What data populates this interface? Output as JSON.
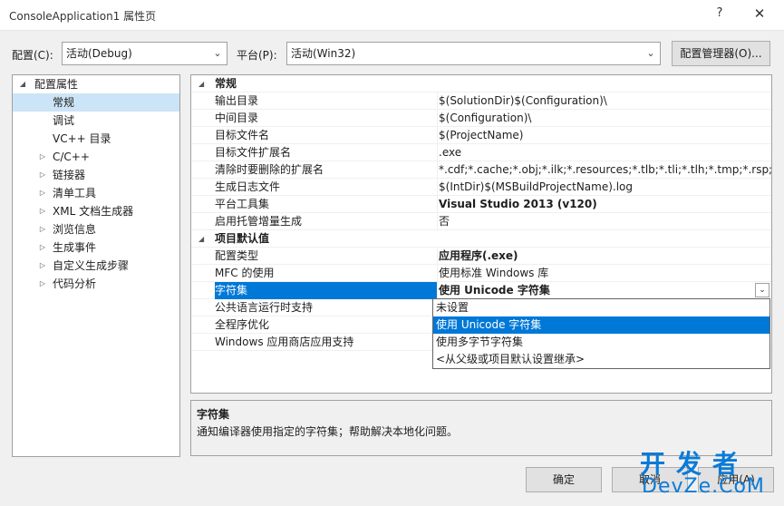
{
  "window": {
    "title": "ConsoleApplication1 属性页",
    "help_label": "?",
    "close_label": "✕"
  },
  "toolbar": {
    "config_label": "配置(C):",
    "config_value": "活动(Debug)",
    "platform_label": "平台(P):",
    "platform_value": "活动(Win32)",
    "config_manager_label": "配置管理器(O)...",
    "dropdown_arrow": "⌄"
  },
  "tree": {
    "root": {
      "label": "配置属性",
      "expander": "◢"
    },
    "items": [
      {
        "label": "常规",
        "expander": "",
        "selected": true
      },
      {
        "label": "调试",
        "expander": ""
      },
      {
        "label": "VC++ 目录",
        "expander": ""
      },
      {
        "label": "C/C++",
        "expander": "▷"
      },
      {
        "label": "链接器",
        "expander": "▷"
      },
      {
        "label": "清单工具",
        "expander": "▷"
      },
      {
        "label": "XML 文档生成器",
        "expander": "▷"
      },
      {
        "label": "浏览信息",
        "expander": "▷"
      },
      {
        "label": "生成事件",
        "expander": "▷"
      },
      {
        "label": "自定义生成步骤",
        "expander": "▷"
      },
      {
        "label": "代码分析",
        "expander": "▷"
      }
    ]
  },
  "grid": {
    "sections": [
      {
        "title": "常规",
        "expander": "◢",
        "rows": [
          {
            "name": "输出目录",
            "value": "$(SolutionDir)$(Configuration)\\"
          },
          {
            "name": "中间目录",
            "value": "$(Configuration)\\"
          },
          {
            "name": "目标文件名",
            "value": "$(ProjectName)"
          },
          {
            "name": "目标文件扩展名",
            "value": ".exe"
          },
          {
            "name": "清除时要删除的扩展名",
            "value": "*.cdf;*.cache;*.obj;*.ilk;*.resources;*.tlb;*.tli;*.tlh;*.tmp;*.rsp;*.pgc;*"
          },
          {
            "name": "生成日志文件",
            "value": "$(IntDir)$(MSBuildProjectName).log"
          },
          {
            "name": "平台工具集",
            "value": "Visual Studio 2013 (v120)",
            "bold": true
          },
          {
            "name": "启用托管增量生成",
            "value": "否"
          }
        ]
      },
      {
        "title": "项目默认值",
        "expander": "◢",
        "rows": [
          {
            "name": "配置类型",
            "value": "应用程序(.exe)",
            "bold": true
          },
          {
            "name": "MFC 的使用",
            "value": "使用标准 Windows 库"
          },
          {
            "name": "字符集",
            "value": "使用 Unicode 字符集",
            "selected": true
          },
          {
            "name": "公共语言运行时支持",
            "value": ""
          },
          {
            "name": "全程序优化",
            "value": ""
          },
          {
            "name": "Windows 应用商店应用支持",
            "value": ""
          }
        ]
      }
    ],
    "dropdown_button": "⌄"
  },
  "dropdown": {
    "options": [
      {
        "label": "未设置"
      },
      {
        "label": "使用 Unicode 字符集",
        "highlighted": true
      },
      {
        "label": "使用多字节字符集"
      },
      {
        "label": "<从父级或项目默认设置继承>"
      }
    ]
  },
  "description": {
    "title": "字符集",
    "text": "通知编译器使用指定的字符集；帮助解决本地化问题。"
  },
  "buttons": {
    "ok": "确定",
    "cancel": "取消",
    "apply": "应用(A)"
  },
  "watermark": {
    "cn": "开发者",
    "en": "DevZe.CoM"
  },
  "colors": {
    "selection": "#0078d7",
    "tree_selection": "#cce4f7",
    "watermark": "#0a7bd8"
  }
}
